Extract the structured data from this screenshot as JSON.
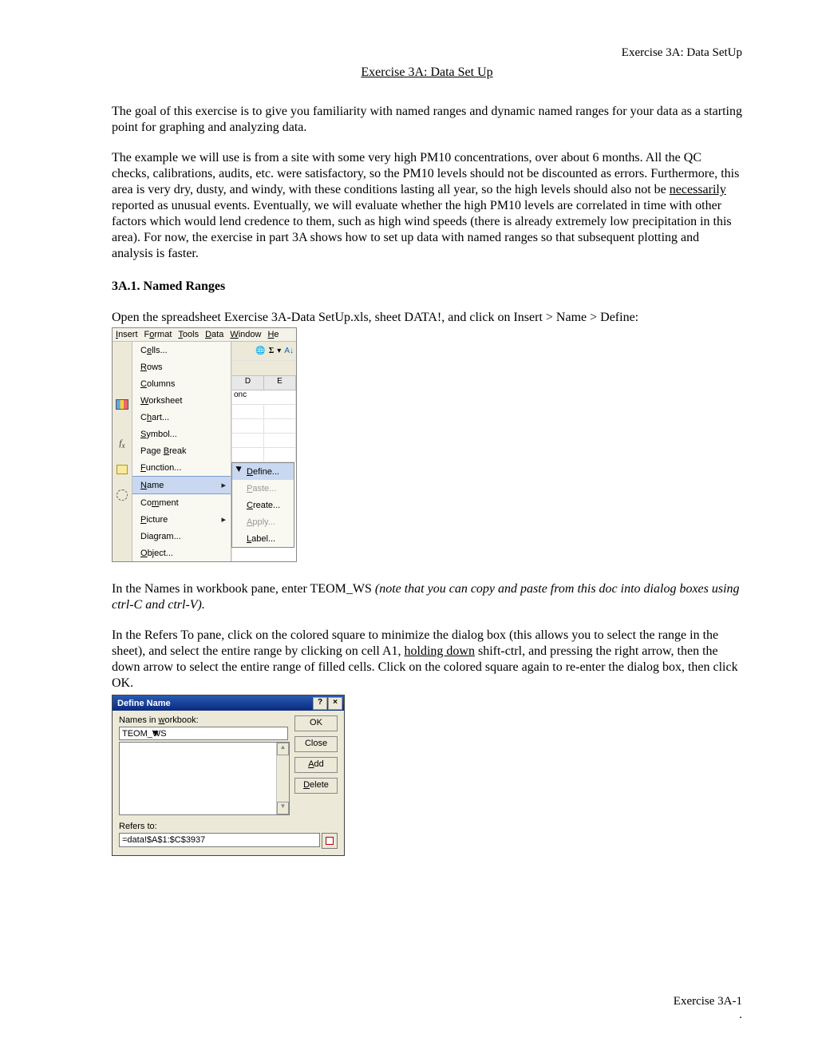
{
  "header_right": "Exercise 3A: Data SetUp",
  "title": "Exercise 3A: Data Set Up",
  "para1": "The goal of this exercise is to give you familiarity with named ranges and dynamic named ranges for your data as a starting point for graphing and analyzing data.",
  "para2_a": "The example we will use is from a site with some very high PM10 concentrations, over about 6 months.  All the QC checks, calibrations, audits, etc. were satisfactory, so the PM10 levels should not be discounted as errors.  Furthermore, this area is very dry, dusty, and windy, with these conditions lasting all year, so the high levels should also not be ",
  "para2_u": "necessarily",
  "para2_b": " reported as unusual events.  Eventually, we will evaluate whether the high PM10 levels are correlated in time with other factors which would lend credence to them, such as high wind speeds (there is already extremely low precipitation in this area).  For now, the exercise in part 3A shows how to set up data with named ranges so that subsequent plotting and analysis is faster.",
  "section_head": "3A.1.  Named Ranges",
  "para3": "Open the spreadsheet Exercise 3A-Data SetUp.xls, sheet DATA!, and click on Insert > Name > Define:",
  "menubar": {
    "insert": "Insert",
    "format": "Format",
    "tools": "Tools",
    "data": "Data",
    "window": "Window",
    "help": "He"
  },
  "insert_menu": {
    "cells": "Cells...",
    "rows": "Rows",
    "columns": "Columns",
    "worksheet": "Worksheet",
    "chart": "Chart...",
    "symbol": "Symbol...",
    "pagebreak": "Page Break",
    "function": "Function...",
    "name": "Name",
    "comment": "Comment",
    "picture": "Picture",
    "diagram": "Diagram...",
    "object": "Object..."
  },
  "name_submenu": {
    "define": "Define...",
    "paste": "Paste...",
    "create": "Create...",
    "apply": "Apply...",
    "label": "Label..."
  },
  "col_d": "D",
  "col_e": "E",
  "cell_onc": "onc",
  "sigma": "Σ",
  "sort_az": "A↓Z",
  "para4_a": "In the Names in workbook pane, enter TEOM_WS  ",
  "para4_i": "(note that you can copy and paste from this doc into dialog boxes using ctrl-C and ctrl-V).",
  "para5_a": "In the Refers To pane, click on the colored square to minimize the dialog box (this allows you to select the range in the sheet), and select the entire range by clicking on cell A1, ",
  "para5_u": "holding down",
  "para5_b": " shift-ctrl, and pressing the right arrow, then the down arrow to select the entire range of filled cells.  Click on the colored square again to re-enter the dialog box, then click OK.",
  "dlg": {
    "title": "Define Name",
    "names_label": "Names in workbook:",
    "names_value": "TEOM_WS",
    "refers_label": "Refers to:",
    "refers_value": "=data!$A$1:$C$3937",
    "ok": "OK",
    "close": "Close",
    "add": "Add",
    "delete": "Delete",
    "help": "?",
    "x": "×"
  },
  "footer": "Exercise 3A-1",
  "footer_dot": "."
}
